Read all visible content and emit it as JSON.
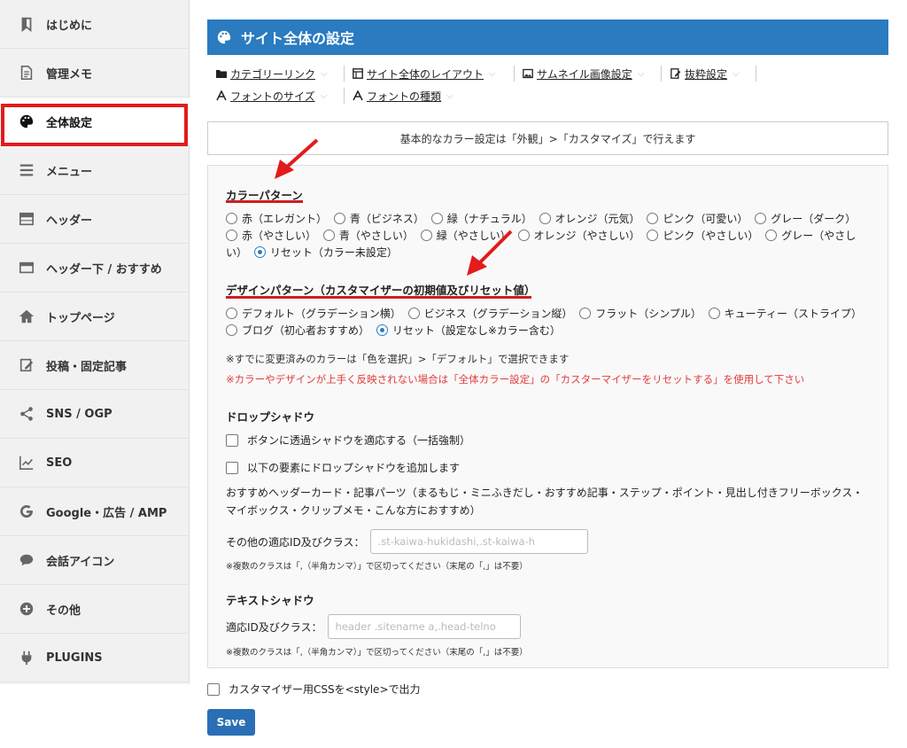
{
  "sidebar": {
    "items": [
      {
        "label": "はじめに",
        "icon": "bookmark-icon"
      },
      {
        "label": "管理メモ",
        "icon": "document-icon"
      },
      {
        "label": "全体設定",
        "icon": "palette-icon"
      },
      {
        "label": "メニュー",
        "icon": "menu-icon"
      },
      {
        "label": "ヘッダー",
        "icon": "header-layout-icon"
      },
      {
        "label": "ヘッダー下 / おすすめ",
        "icon": "card-icon"
      },
      {
        "label": "トップページ",
        "icon": "home-icon"
      },
      {
        "label": "投稿・固定記事",
        "icon": "edit-icon"
      },
      {
        "label": "SNS / OGP",
        "icon": "share-icon"
      },
      {
        "label": "SEO",
        "icon": "chart-line-icon"
      },
      {
        "label": "Google・広告 / AMP",
        "icon": "google-icon"
      },
      {
        "label": "会話アイコン",
        "icon": "speech-bubble-icon"
      },
      {
        "label": "その他",
        "icon": "plus-circle-icon"
      },
      {
        "label": "PLUGINS",
        "icon": "plug-icon"
      }
    ]
  },
  "header": {
    "title": "サイト全体の設定"
  },
  "tabs": [
    {
      "label": "カテゴリーリンク",
      "icon": "folder-icon"
    },
    {
      "label": "サイト全体のレイアウト",
      "icon": "layout-icon"
    },
    {
      "label": "サムネイル画像設定",
      "icon": "image-icon"
    },
    {
      "label": "抜粋設定",
      "icon": "excerpt-icon"
    },
    {
      "label": "フォントのサイズ",
      "icon": "font-size-icon"
    },
    {
      "label": "フォントの種類",
      "icon": "font-type-icon"
    }
  ],
  "info": "基本的なカラー設定は「外観」>「カスタマイズ」で行えます",
  "color_pattern": {
    "title": "カラーパターン",
    "options": [
      "赤（エレガント）",
      "青（ビジネス）",
      "緑（ナチュラル）",
      "オレンジ（元気）",
      "ピンク（可愛い）",
      "グレー（ダーク）",
      "赤（やさしい）",
      "青（やさしい）",
      "緑（やさしい）",
      "オレンジ（やさしい）",
      "ピンク（やさしい）",
      "グレー（やさしい）",
      "リセット（カラー未設定）"
    ],
    "selected": 12
  },
  "design_pattern": {
    "title": "デザインパターン（カスタマイザーの初期値及びリセット値）",
    "options": [
      "デフォルト（グラデーション横）",
      "ビジネス（グラデーション縦）",
      "フラット（シンプル）",
      "キューティー（ストライプ）",
      "ブログ（初心者おすすめ）",
      "リセット（設定なし※カラー含む）"
    ],
    "selected": 5
  },
  "notes": {
    "note1": "※すでに変更済みのカラーは「色を選択」>「デフォルト」で選択できます",
    "note2": "※カラーやデザインが上手く反映されない場合は「全体カラー設定」の「カスターマイザーをリセットする」を使用して下さい"
  },
  "drop_shadow": {
    "title": "ドロップシャドウ",
    "check1": "ボタンに透過シャドウを適応する（一括強制）",
    "check2": "以下の要素にドロップシャドウを追加します",
    "desc": "おすすめヘッダーカード・記事パーツ（まるもじ・ミニふきだし・おすすめ記事・ステップ・ポイント・見出し付きフリーボックス・マイボックス・クリップメモ・こんな方におすすめ）",
    "field_label": "その他の適応ID及びクラス：",
    "field_placeholder": ".st-kaiwa-hukidashi,.st-kaiwa-h",
    "hint": "※複数のクラスは「,（半角カンマ）」で区切ってください（末尾の「,」は不要）"
  },
  "text_shadow": {
    "title": "テキストシャドウ",
    "field_label": "適応ID及びクラス：",
    "field_placeholder": "header .sitename a,.head-telno",
    "hint": "※複数のクラスは「,（半角カンマ）」で区切ってください（末尾の「,」は不要）"
  },
  "css_output": "カスタマイザー用CSSを<style>で出力",
  "save_label": "Save",
  "colors": {
    "accent": "#2a7bc0",
    "highlight": "#e21b1b",
    "warning_text": "#e23c3c"
  }
}
